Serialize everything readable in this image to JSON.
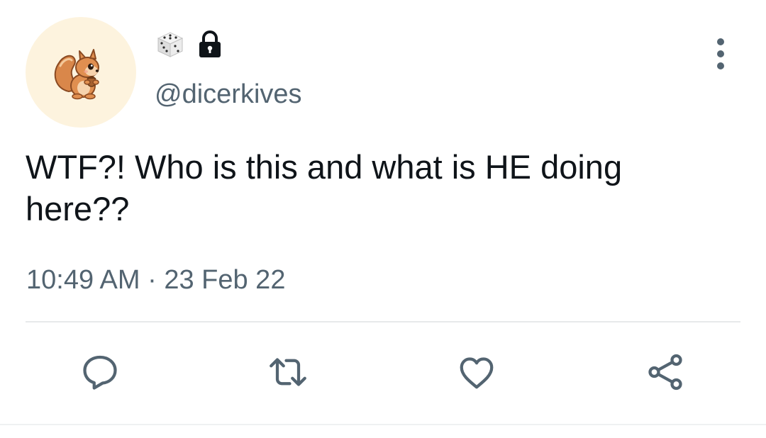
{
  "author": {
    "avatar_icon": "squirrel-avatar",
    "display_name_icons": [
      "die-emoji",
      "lock-icon"
    ],
    "handle": "@dicerkives",
    "protected": true
  },
  "tweet": {
    "text": "WTF?! Who is this and what is HE doing here??",
    "timestamp": "10:49 AM · 23 Feb 22"
  },
  "actions": [
    {
      "name": "reply",
      "icon": "reply-icon"
    },
    {
      "name": "retweet",
      "icon": "retweet-icon"
    },
    {
      "name": "like",
      "icon": "heart-icon"
    },
    {
      "name": "share",
      "icon": "share-icon"
    }
  ],
  "menu": {
    "icon": "more-options-icon"
  },
  "colors": {
    "text_primary": "#0f1419",
    "text_secondary": "#536471",
    "avatar_bg": "#fdf3de",
    "divider": "#e7e9ea"
  }
}
